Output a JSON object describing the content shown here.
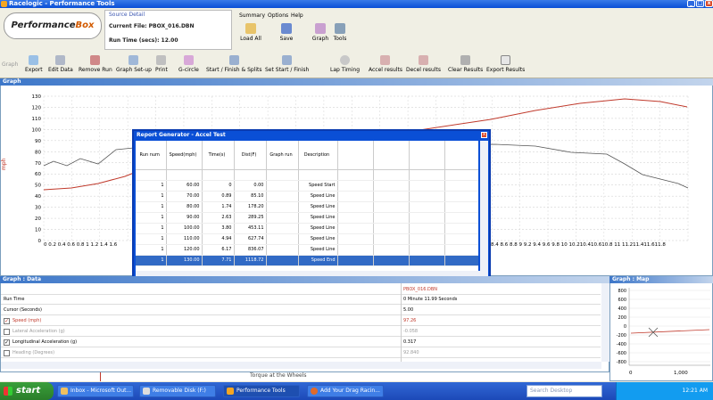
{
  "window": {
    "title": "Racelogic - Performance Tools"
  },
  "logo": {
    "text_a": "Performance",
    "text_b": "Box"
  },
  "source": {
    "label": "Source Detail",
    "file": "Current File: PBOX_016.DBN",
    "run_time": "Run Time (secs): 12.00"
  },
  "menu_tabs": [
    "Summary",
    "Options",
    "Help"
  ],
  "toolbar_top": [
    "Load All",
    "Save",
    "Graph",
    "Tools"
  ],
  "toolbar2": {
    "graph_label": "Graph",
    "items": [
      "Export",
      "Edit Data",
      "Remove Run",
      "Graph Set-up",
      "Print",
      "G-circle",
      "Start / Finish & Splits",
      "Set Start / Finish",
      "Lap Timing",
      "Accel results",
      "Decel results",
      "Clear Results",
      "Export Results"
    ]
  },
  "graph": {
    "title": "Graph",
    "y_label": "mph",
    "y_ticks": [
      "130",
      "120",
      "110",
      "100",
      "90",
      "80",
      "70",
      "60",
      "50",
      "40",
      "30",
      "20",
      "10",
      "0"
    ],
    "x_ticks_left": [
      "0",
      "0.2",
      "0.4",
      "0.6",
      "0.8",
      "1",
      "1.2",
      "1.4",
      "1.6"
    ],
    "x_ticks_right": "8.4 8.6 8.8  9  9.2 9.4 9.6 9.8  10 10.210.410.610.8 11 11.211.411.611.8"
  },
  "report": {
    "title": "Report Generator - Accel Test",
    "columns": [
      "Run num",
      "Speed(mph)",
      "Time(s)",
      "Dist(F)",
      "Graph run",
      "Description"
    ],
    "rows": [
      {
        "run": "1",
        "speed": "60.00",
        "time": "0",
        "dist": "0.00",
        "desc": "Speed Start"
      },
      {
        "run": "1",
        "speed": "70.00",
        "time": "0.89",
        "dist": "85.10",
        "desc": "Speed Line"
      },
      {
        "run": "1",
        "speed": "80.00",
        "time": "1.74",
        "dist": "178.20",
        "desc": "Speed Line"
      },
      {
        "run": "1",
        "speed": "90.00",
        "time": "2.63",
        "dist": "289.25",
        "desc": "Speed Line"
      },
      {
        "run": "1",
        "speed": "100.00",
        "time": "3.80",
        "dist": "453.11",
        "desc": "Speed Line"
      },
      {
        "run": "1",
        "speed": "110.00",
        "time": "4.94",
        "dist": "627.74",
        "desc": "Speed Line"
      },
      {
        "run": "1",
        "speed": "120.00",
        "time": "6.17",
        "dist": "836.07",
        "desc": "Speed Line"
      },
      {
        "run": "1",
        "speed": "130.00",
        "time": "7.71",
        "dist": "1118.72",
        "desc": "Speed End"
      }
    ]
  },
  "data_pane": {
    "title": "Graph : Data",
    "file": "PBOX_016.DBN",
    "rows": [
      {
        "label": "Run Time",
        "value": "0 Minute 11.99 Seconds",
        "checkbox": false,
        "checked": false,
        "color": "#000000"
      },
      {
        "label": "Cursor (Seconds)",
        "value": "5.00",
        "checkbox": false,
        "checked": false,
        "color": "#000000"
      },
      {
        "label": "Speed (mph)",
        "value": "97.26",
        "checkbox": true,
        "checked": true,
        "color": "#c0392b"
      },
      {
        "label": "Lateral Acceleration (g)",
        "value": "-0.058",
        "checkbox": true,
        "checked": false,
        "color": "#9a9a9a"
      },
      {
        "label": "Longitudinal Acceleration (g)",
        "value": "0.317",
        "checkbox": true,
        "checked": true,
        "color": "#000000"
      },
      {
        "label": "Heading (Degrees)",
        "value": "92.840",
        "checkbox": true,
        "checked": false,
        "color": "#9a9a9a"
      }
    ],
    "status_text": "Torque at the Wheels"
  },
  "map_pane": {
    "title": "Graph : Map",
    "y_ticks": [
      "800",
      "600",
      "400",
      "200",
      "0",
      "-200",
      "-400",
      "-600",
      "-800"
    ],
    "x_ticks": [
      "0",
      "1,000"
    ]
  },
  "taskbar": {
    "start": "start",
    "tasks": [
      "Inbox - Microsoft Out...",
      "Removable Disk (F:)",
      "Performance Tools",
      "Add Your Drag Racin..."
    ],
    "search": "Search Desktop",
    "clock": "12:21 AM"
  }
}
